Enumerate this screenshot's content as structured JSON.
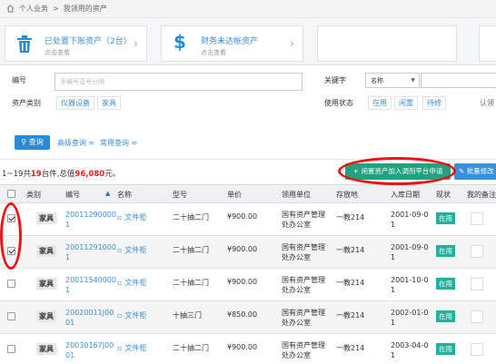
{
  "breadcrumb": {
    "home": "个人业务",
    "sep": ">",
    "current": "我领用的资产"
  },
  "cards": [
    {
      "title": "已处置下账资产（2台）",
      "sub": "点击查看",
      "icon": "trash-icon"
    },
    {
      "title": "财务未达帐资产",
      "sub": "点击查看",
      "icon": "dollar-icon"
    }
  ],
  "filter": {
    "code_label": "编号",
    "code_placeholder": "多编号逗号分隔",
    "keyword_label": "关键字",
    "keyword_select": "名称",
    "category_label": "资产类别",
    "categories": [
      "仪器设备",
      "家具"
    ],
    "status_label": "使用状态",
    "statuses": [
      "在用",
      "闲置",
      "待修"
    ],
    "extra_label": "认领",
    "query_button": "查询",
    "advanced": "高级查询 ≈",
    "common": "常用查询 ≈"
  },
  "summary_line": {
    "prefix": "1~19共",
    "count": "19",
    "middle": "台件,总值",
    "value": "96,080",
    "suffix": "元。"
  },
  "actions": {
    "idle_button": "闲置资产加入调剂平台申请",
    "batch_button": "批量修改"
  },
  "table": {
    "headers": [
      "类别",
      "编号",
      "名称",
      "型号",
      "单价",
      "领用单位",
      "存放地",
      "入库日期",
      "现状",
      "我的备注"
    ],
    "sort_indicator": "▲",
    "rows": [
      {
        "checked": true,
        "category": "家具",
        "code1": "20011290000",
        "code2": "1",
        "name": "文件柜",
        "model": "二十抽二门",
        "price": "¥900.00",
        "unit1": "国有资产管理",
        "unit2": "处办公室",
        "place": "一教214",
        "date1": "2001-09-0",
        "date2": "1",
        "status": "在用"
      },
      {
        "checked": true,
        "category": "家具",
        "code1": "20011291000",
        "code2": "1",
        "name": "文件柜",
        "model": "二十抽二门",
        "price": "¥900.00",
        "unit1": "国有资产管理",
        "unit2": "处办公室",
        "place": "一教214",
        "date1": "2001-09-0",
        "date2": "1",
        "status": "在用"
      },
      {
        "checked": false,
        "category": "家具",
        "code1": "20011540000",
        "code2": "1",
        "name": "文件柜",
        "model": "二十抽二门",
        "price": "¥900.00",
        "unit1": "国有资产管理",
        "unit2": "处办公室",
        "place": "一教214",
        "date1": "2001-10-0",
        "date2": "1",
        "status": "在用"
      },
      {
        "checked": false,
        "category": "家具",
        "code1": "20020011J00",
        "code2": "01",
        "name": "文件柜",
        "model": "十抽三门",
        "price": "¥850.00",
        "unit1": "国有资产管理",
        "unit2": "处办公室",
        "place": "一教214",
        "date1": "2002-01-0",
        "date2": "1",
        "status": "在用"
      },
      {
        "checked": false,
        "category": "家具",
        "code1": "20030167J00",
        "code2": "01",
        "name": "文件柜",
        "model": "二十抽二门",
        "price": "¥900.00",
        "unit1": "国有资产管理",
        "unit2": "处办公室",
        "place": "一教214",
        "date1": "2003-04-0",
        "date2": "1",
        "status": "在用"
      }
    ]
  },
  "colors": {
    "accent": "#3a8fd8",
    "green": "#23a07e",
    "status": "#25b09b",
    "annotation": "#ee1111"
  }
}
